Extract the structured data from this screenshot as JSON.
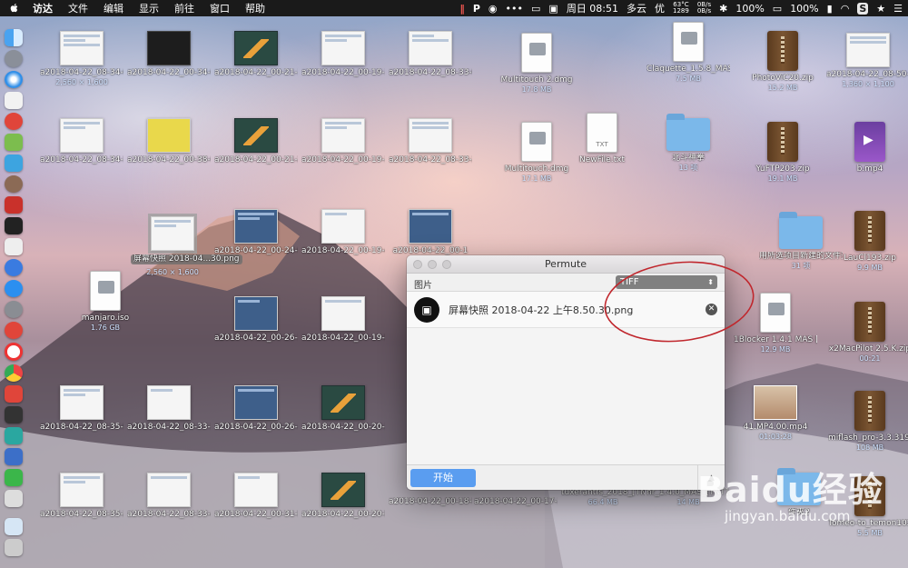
{
  "menubar": {
    "app": "访达",
    "menus": [
      "文件",
      "编辑",
      "显示",
      "前往",
      "窗口",
      "帮助"
    ],
    "cpu_temp": "63°C",
    "cpu_rpm": "1289",
    "net_up": "0B/s",
    "net_down": "0B/s",
    "datetime": "周日 08:51",
    "weather": "多云",
    "ime": "优",
    "battery1": "100%",
    "battery2": "100%"
  },
  "desktop": {
    "items": [
      {
        "label": "a2018-04-22_08-34-02.jpg",
        "sub": "2,560 × 1,600",
        "kind": "thumb-app"
      },
      {
        "label": "a2018-04-22_00-34-05.jpg",
        "sub": "",
        "kind": "thumb-dark"
      },
      {
        "label": "a2018-04-22_00-21-13.jpg",
        "sub": "",
        "kind": "thumb-green"
      },
      {
        "label": "a2018-04-22_00-19-17.jpg",
        "sub": "",
        "kind": "thumb-app"
      },
      {
        "label": "a2018-04-22_08-33-02.jpg",
        "sub": "",
        "kind": "thumb-app"
      },
      {
        "label": "Multitouch 2.dmg",
        "sub": "17.8 MB",
        "kind": "doc"
      },
      {
        "label": "Claquette_1.5.8_MAS_In-A_NT].dmg",
        "sub": "7.5 MB",
        "kind": "doc"
      },
      {
        "label": "PhotoViC20.zip",
        "sub": "15.2 MB",
        "kind": "zip"
      },
      {
        "label": "a2018-04-22_08-50-54.jpg",
        "sub": "1,360 × 1,100",
        "kind": "thumb-app"
      },
      {
        "label": "a2018-04-22_08-34-59.jpg",
        "sub": "",
        "kind": "thumb-app"
      },
      {
        "label": "a2018-04-22_00-38-00.jpg",
        "sub": "",
        "kind": "thumb-app"
      },
      {
        "label": "a2018-04-22_00-21-27.jpg",
        "sub": "",
        "kind": "thumb-green"
      },
      {
        "label": "a2018-04-22_00-19-31.jpg",
        "sub": "",
        "kind": "thumb-app"
      },
      {
        "label": "a2018-04-22_08-33-22.jpg",
        "sub": "",
        "kind": "thumb-app"
      },
      {
        "label": "Multitouch.dmg",
        "sub": "17.1 MB",
        "kind": "doc"
      },
      {
        "label": "NewFile.txt",
        "sub": "",
        "kind": "txt"
      },
      {
        "label": "北斗神拳",
        "sub": "13 项",
        "kind": "folder"
      },
      {
        "label": "YuFTP203.zip",
        "sub": "19.1 MB",
        "kind": "zip"
      },
      {
        "label": "b.mp4",
        "sub": "",
        "kind": "mp4"
      },
      {
        "label": "屏幕快照 2018-04...30.png",
        "sub": "2,560 × 1,600",
        "kind": "thumb-app"
      },
      {
        "label": "a2018-04-22_00-24-06.jpg",
        "sub": "",
        "kind": "thumb-blue"
      },
      {
        "label": "a2018-04-22_00-19-45.jpg",
        "sub": "",
        "kind": "thumb-app"
      },
      {
        "label": "a2018-04-22_00-1",
        "sub": "",
        "kind": "thumb-blue"
      },
      {
        "label": "用所选项目新建的文件夹",
        "sub": "31 项",
        "kind": "folder"
      },
      {
        "label": "LauCl193.zip",
        "sub": "9.9 MB",
        "kind": "zip"
      },
      {
        "label": "manjaro.iso",
        "sub": "1.76 GB",
        "kind": "doc"
      },
      {
        "label": "a2018-04-22_00-26-19.jpg",
        "sub": "",
        "kind": "thumb-blue"
      },
      {
        "label": "a2018-04-22_00-19-57.jpg",
        "sub": "",
        "kind": "thumb-app"
      },
      {
        "label": "1Blocker 1.4.1 MAS [TNT].dmg",
        "sub": "12.9 MB",
        "kind": "doc"
      },
      {
        "label": "x2MacPilot 2.5.K.zip",
        "sub": "00:21",
        "kind": "zip"
      },
      {
        "label": "a2018-04-22_08-35-08.jpg",
        "sub": "",
        "kind": "thumb-app"
      },
      {
        "label": "a2018-04-22_08-33-35.jpg",
        "sub": "",
        "kind": "thumb-app"
      },
      {
        "label": "a2018-04-22_00-26-47.jpg",
        "sub": "",
        "kind": "thumb-blue"
      },
      {
        "label": "a2018-04-22_00-20-31.jpg",
        "sub": "",
        "kind": "thumb-green"
      },
      {
        "label": "41.MP4.00.mp4",
        "sub": "01:03:28",
        "kind": "photo"
      },
      {
        "label": "miflash_pro-3.3.319.52.zip",
        "sub": "108 MB",
        "kind": "zip"
      },
      {
        "label": "a2018-04-22_08-35-21.jpg",
        "sub": "",
        "kind": "thumb-app"
      },
      {
        "label": "a2018-04-22_08-33-46.jpg",
        "sub": "",
        "kind": "thumb-app"
      },
      {
        "label": "a2018-04-22_00-31-53.jpg",
        "sub": "",
        "kind": "thumb-app"
      },
      {
        "label": "a2018-04-22_00-20-51.jpg",
        "sub": "",
        "kind": "thumb-green"
      },
      {
        "label": "a2018-04-22_00-18-56.jpg",
        "sub": "",
        "kind": "thumb-app"
      },
      {
        "label": "a2018-04-22_00-17-36.jpg",
        "sub": "",
        "kind": "thumb-blue"
      },
      {
        "label": "tuxerantfs_2018_[TNT].dmg",
        "sub": "66.4 MB",
        "kind": "doc"
      },
      {
        "label": "hr_1.4.0_MAS_[TNT].dmg",
        "sub": "14 MB",
        "kind": "doc"
      },
      {
        "label": "件夹2",
        "sub": "",
        "kind": "folder"
      },
      {
        "label": "Tomeo-to_temon102.zip",
        "sub": "5.5 MB",
        "kind": "zip"
      }
    ]
  },
  "permute": {
    "title": "Permute",
    "category": "图片",
    "format": "TIFF",
    "file_name": "屏幕快照 2018-04-22 上午8.50.30.png",
    "start_label": "开始"
  },
  "watermark": {
    "logo": "Baidu经验",
    "url": "jingyan.baidu.com"
  },
  "colors": {
    "menubar": "#1a1a1a",
    "start_button": "#5a9df0",
    "annotation": "#c0272d"
  }
}
